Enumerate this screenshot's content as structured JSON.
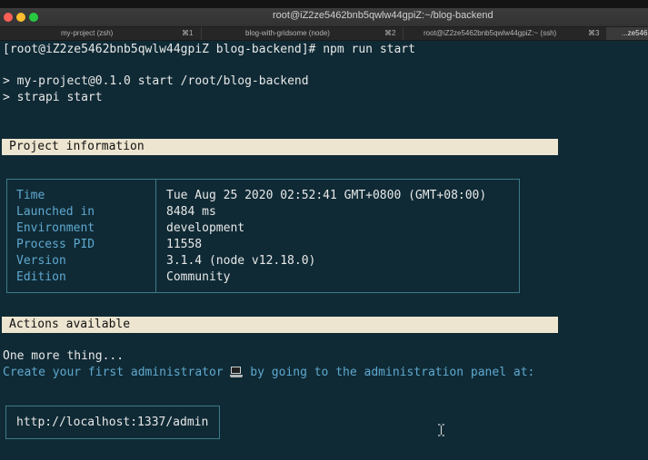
{
  "window": {
    "title": "root@iZ2ze5462bnb5qwlw44gpiZ:~/blog-backend"
  },
  "tabs": [
    {
      "name": "my-project (zsh)",
      "key": "⌘1"
    },
    {
      "name": "blog-with-gridsome (node)",
      "key": "⌘2"
    },
    {
      "name": "root@iZ2ze5462bnb5qwlw44gpiZ:~ (ssh)",
      "key": "⌘3"
    },
    {
      "name": "...ze546",
      "key": ""
    }
  ],
  "terminal": {
    "prompt_line": "[root@iZ2ze5462bnb5qwlw44gpiZ blog-backend]# npm run start",
    "script_line1": "> my-project@0.1.0 start /root/blog-backend",
    "script_line2": "> strapi start",
    "project_info_title": "Project information",
    "info_rows": [
      {
        "key": "Time",
        "value": "Tue Aug 25 2020 02:52:41 GMT+0800 (GMT+08:00)"
      },
      {
        "key": "Launched in",
        "value": "8484 ms"
      },
      {
        "key": "Environment",
        "value": "development"
      },
      {
        "key": "Process PID",
        "value": "11558"
      },
      {
        "key": "Version",
        "value": "3.1.4 (node v12.18.0)"
      },
      {
        "key": "Edition",
        "value": "Community"
      }
    ],
    "actions_title": "Actions available",
    "one_more": "One more thing...",
    "create_admin_before": "Create your first administrator ",
    "create_admin_after": " by going to the administration panel at:",
    "admin_url": "http://localhost:1337/admin"
  },
  "icons": {
    "laptop": "laptop-icon",
    "cursor": "text-cursor-icon"
  },
  "colors": {
    "background": "#0f2a35",
    "accent_cyan": "#5fa8cf",
    "banner_bg": "#ede5d0",
    "box_border": "#3c7a86"
  }
}
